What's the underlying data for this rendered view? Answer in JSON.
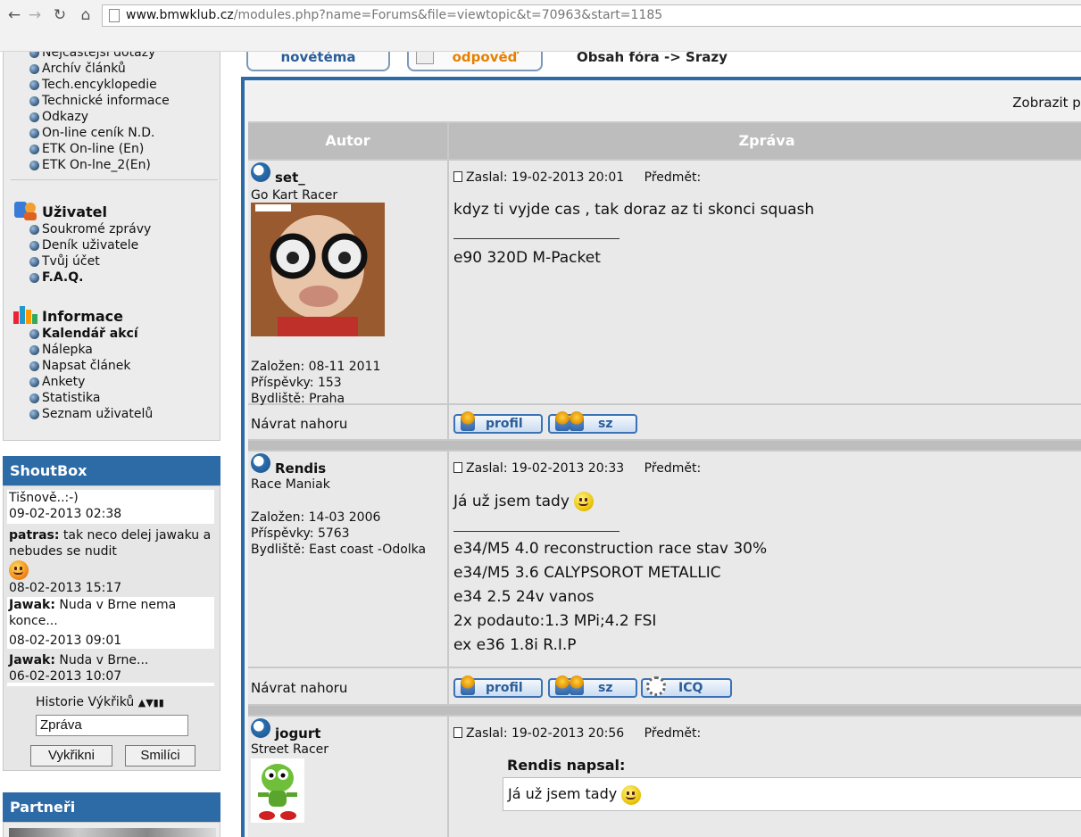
{
  "browser": {
    "url_host": "www.bmwklub.cz",
    "url_path": "/modules.php?name=Forums&file=viewtopic&t=70963&start=1185"
  },
  "left_menu": {
    "top_items": [
      "Nejčastější dotazy",
      "Archív článků",
      "Tech.encyklopedie",
      "Technické informace",
      "Odkazy",
      "On-line ceník N.D.",
      "ETK On-line (En)",
      "ETK On-lne_2(En)"
    ],
    "user_section": {
      "title": "Uživatel",
      "items": [
        "Soukromé zprávy",
        "Deník uživatele",
        "Tvůj účet",
        "F.A.Q."
      ]
    },
    "info_section": {
      "title": "Informace",
      "items": [
        "Kalendář akcí",
        "Nálepka",
        "Napsat článek",
        "Ankety",
        "Statistika",
        "Seznam uživatelů"
      ]
    }
  },
  "shoutbox": {
    "title": "ShoutBox",
    "entries": [
      {
        "author": "",
        "text": "Tišnově..:-)",
        "time": "09-02-2013 02:38"
      },
      {
        "author": "patras:",
        "text": "tak neco delej jawaku a nebudes se nudit",
        "time": "08-02-2013 15:17"
      },
      {
        "author": "Jawak:",
        "text": "Nuda v Brne nema konce...",
        "time": "08-02-2013 09:01"
      },
      {
        "author": "Jawak:",
        "text": "Nuda v Brne...",
        "time": "06-02-2013 10:07"
      }
    ],
    "history_label": "Historie Výkřiků",
    "input_value": "Zpráva",
    "shout_button": "Vykřikni",
    "smileys_button": "Smilíci"
  },
  "partners": {
    "title": "Partneři"
  },
  "topic": {
    "new_topic_label": "novétéma",
    "reply_label": "odpověď",
    "breadcrumb": "Obsah fóra -> Srazy",
    "show_label": "Zobrazit pi",
    "col_author": "Autor",
    "col_message": "Zpráva",
    "back_to_top": "Návrat nahoru"
  },
  "posts": [
    {
      "username": "set_",
      "rank": "Go Kart Racer",
      "joined": "Založen: 08-11 2011",
      "posts": "Příspěvky: 153",
      "location": "Bydliště: Praha",
      "posted": "Zaslal: 19-02-2013 20:01",
      "subject": "Předmět:",
      "body": "kdyz ti vyjde cas , tak doraz az ti skonci squash",
      "signature": [
        "e90 320D M-Packet"
      ],
      "buttons": [
        "profil",
        "sz"
      ]
    },
    {
      "username": "Rendis",
      "rank": "Race Maniak",
      "joined": "Založen: 14-03 2006",
      "posts": "Příspěvky: 5763",
      "location": "Bydliště: East coast -Odolka",
      "posted": "Zaslal: 19-02-2013 20:33",
      "subject": "Předmět:",
      "body": "Já už jsem tady",
      "signature": [
        "e34/M5 4.0 reconstruction race stav 30%",
        "e34/M5 3.6 CALYPSOROT METALLIC",
        "e34 2.5 24v vanos",
        "2x podauto:1.3 MPi;4.2 FSI",
        "ex e36 1.8i R.I.P"
      ],
      "buttons": [
        "profil",
        "sz",
        "ICQ"
      ]
    },
    {
      "username": "jogurt",
      "rank": "Street Racer",
      "posted": "Zaslal: 19-02-2013 20:56",
      "subject": "Předmět:",
      "quote_author": "Rendis napsal:",
      "quote_text": "Já už jsem tady"
    }
  ]
}
